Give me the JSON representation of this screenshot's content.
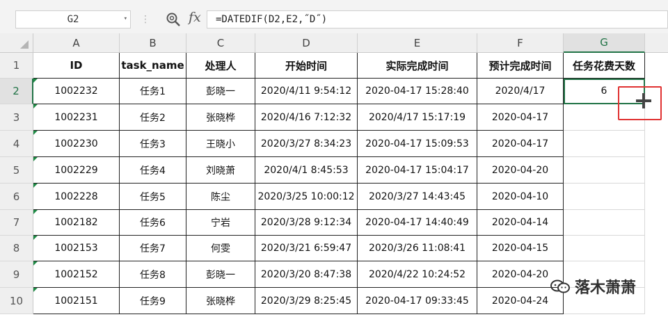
{
  "formula_bar": {
    "name_box": "G2",
    "fx_label": "fx",
    "formula": "=DATEDIF(D2,E2,˝D˝)"
  },
  "columns": [
    "A",
    "B",
    "C",
    "D",
    "E",
    "F",
    "G"
  ],
  "selected_column": "G",
  "selected_row": "2",
  "row_numbers": [
    "1",
    "2",
    "3",
    "4",
    "5",
    "6",
    "7",
    "8",
    "9",
    "10"
  ],
  "table": {
    "headers": [
      "ID",
      "task_name",
      "处理人",
      "开始时间",
      "实际完成时间",
      "预计完成时间",
      "任务花费天数"
    ],
    "rows": [
      [
        "1002232",
        "任务1",
        "彭晓一",
        "2020/4/11 9:54:12",
        "2020-04-17 15:28:40",
        "2020/4/17",
        "6"
      ],
      [
        "1002231",
        "任务2",
        "张晓桦",
        "2020/4/16 7:12:32",
        "2020/4/17 15:17:19",
        "2020-04-17",
        ""
      ],
      [
        "1002230",
        "任务3",
        "王晓小",
        "2020/3/27 8:34:23",
        "2020-04-17 15:09:53",
        "2020-04-17",
        ""
      ],
      [
        "1002229",
        "任务4",
        "刘晓萧",
        "2020/4/1 8:45:53",
        "2020-04-17 15:04:17",
        "2020-04-20",
        ""
      ],
      [
        "1002228",
        "任务5",
        "陈尘",
        "2020/3/25 10:00:12",
        "2020/3/27 14:43:45",
        "2020-04-10",
        ""
      ],
      [
        "1002182",
        "任务6",
        "宁岩",
        "2020/3/28 9:12:34",
        "2020-04-17 14:40:49",
        "2020-04-14",
        ""
      ],
      [
        "1002153",
        "任务7",
        "何雯",
        "2020/3/21 6:59:47",
        "2020/3/26 11:08:41",
        "2020-04-15",
        ""
      ],
      [
        "1002152",
        "任务8",
        "彭晓一",
        "2020/3/20 8:47:38",
        "2020/4/22 10:24:52",
        "2020-04-20",
        ""
      ],
      [
        "1002151",
        "任务9",
        "张晓桦",
        "2020/3/29 8:25:45",
        "2020-04-17 09:33:45",
        "2020-04-24",
        ""
      ]
    ]
  },
  "watermark": {
    "text": "落木萧萧",
    "icon": "wechat-icon"
  },
  "colors": {
    "accent": "#217346",
    "highlight": "#e03131"
  }
}
